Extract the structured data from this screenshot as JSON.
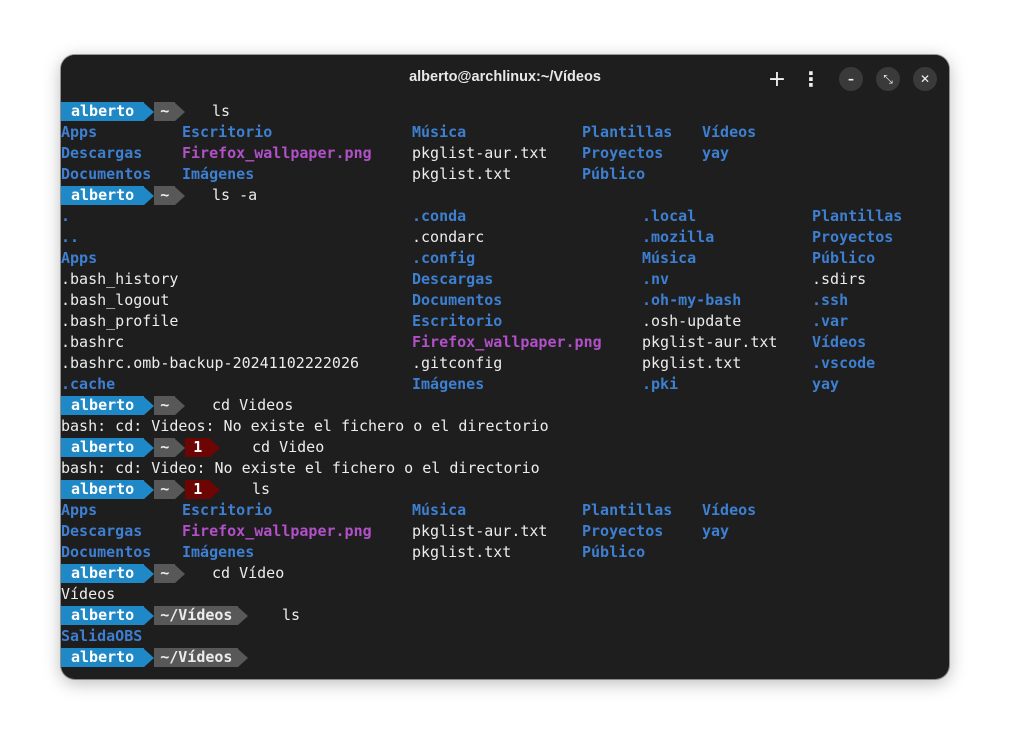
{
  "window": {
    "title": "alberto@archlinux:~/Vídeos"
  },
  "titlebar": {
    "new_tab": "+",
    "menu": "⋮",
    "minimize": "–",
    "restore": "⤡",
    "close": "✕"
  },
  "prompt": {
    "user": "alberto",
    "home": "~",
    "videos_dir": "~/Vídeos",
    "error_code": "1"
  },
  "commands": {
    "c1": "ls",
    "c2": "ls -a",
    "c3": "cd Videos",
    "c4": "cd Video",
    "c5": "ls",
    "c6": "cd Vídeo",
    "c7": "ls"
  },
  "outputs": {
    "err1": "bash: cd: Videos: No existe el fichero o el directorio",
    "err2": "bash: cd: Video: No existe el fichero o el directorio",
    "cd_result": "Vídeos"
  },
  "ls_home": [
    [
      "Apps",
      "Escritorio",
      "Música",
      "Plantillas",
      "Vídeos"
    ],
    [
      "Descargas",
      "Firefox_wallpaper.png",
      "pkglist-aur.txt",
      "Proyectos",
      "yay"
    ],
    [
      "Documentos",
      "Imágenes",
      "pkglist.txt",
      "Público",
      ""
    ]
  ],
  "ls_all": [
    [
      ".",
      ".conda",
      ".local",
      "Plantillas"
    ],
    [
      "..",
      ".condarc",
      ".mozilla",
      "Proyectos"
    ],
    [
      "Apps",
      ".config",
      "Música",
      "Público"
    ],
    [
      ".bash_history",
      "Descargas",
      ".nv",
      ".sdirs"
    ],
    [
      ".bash_logout",
      "Documentos",
      ".oh-my-bash",
      ".ssh"
    ],
    [
      ".bash_profile",
      "Escritorio",
      ".osh-update",
      ".var"
    ],
    [
      ".bashrc",
      "Firefox_wallpaper.png",
      "pkglist-aur.txt",
      "Vídeos"
    ],
    [
      ".bashrc.omb-backup-20241102222026",
      ".gitconfig",
      "pkglist.txt",
      ".vscode"
    ],
    [
      ".cache",
      "Imágenes",
      ".pki",
      "yay"
    ]
  ],
  "ls_videos": [
    "SalidaOBS"
  ],
  "colors": {
    "directory": "#3d7fd1",
    "image": "#b150c8",
    "file": "#ececec",
    "prompt_user_bg": "#1f88c7",
    "prompt_dir_bg": "#585858",
    "prompt_error_bg": "#6e0505",
    "terminal_bg": "#1e1e1e"
  }
}
